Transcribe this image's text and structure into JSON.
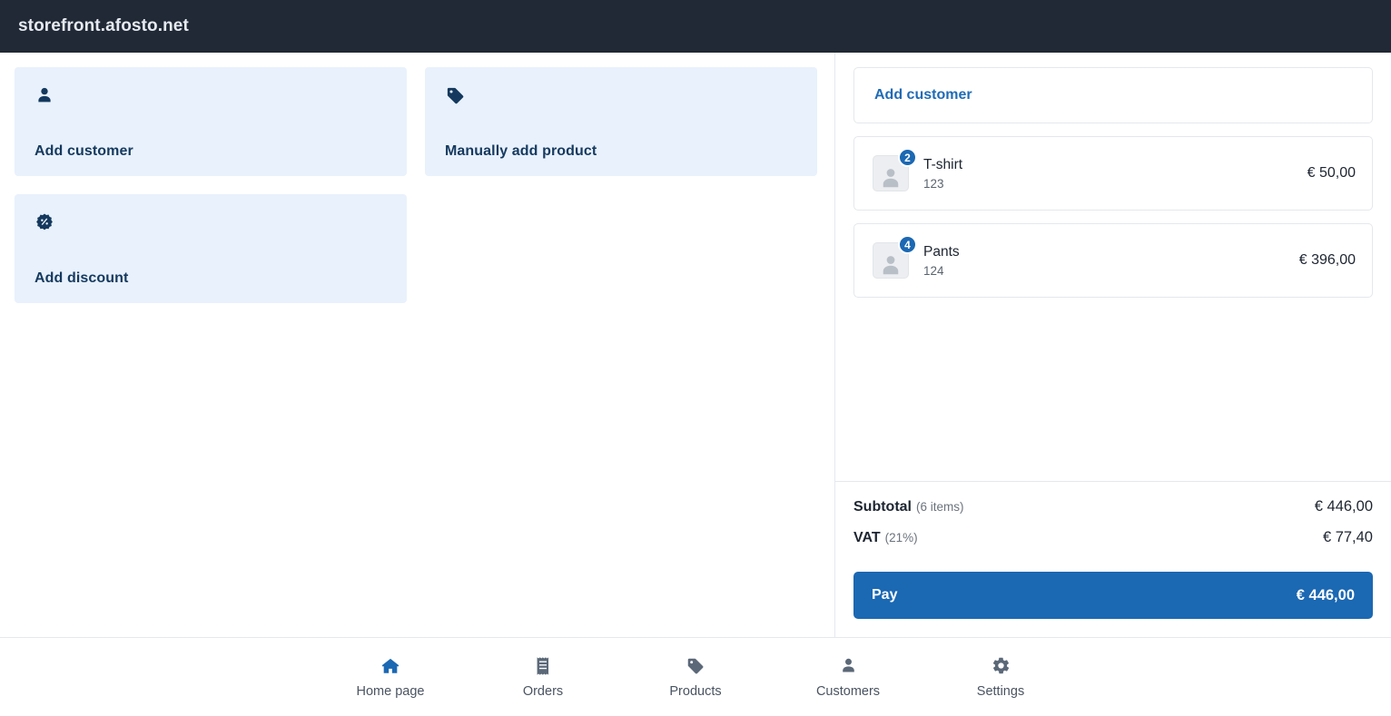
{
  "topbar": {
    "title": "storefront.afosto.net"
  },
  "actions": [
    {
      "label": "Add customer",
      "icon": "person-icon"
    },
    {
      "label": "Manually add product",
      "icon": "tag-icon"
    },
    {
      "label": "Add discount",
      "icon": "discount-badge-icon"
    }
  ],
  "cart": {
    "add_customer_label": "Add customer",
    "items": [
      {
        "qty": "2",
        "name": "T-shirt",
        "sku": "123",
        "price": "€ 50,00"
      },
      {
        "qty": "4",
        "name": "Pants",
        "sku": "124",
        "price": "€ 396,00"
      }
    ],
    "totals": [
      {
        "label": "Subtotal",
        "sub": "(6 items)",
        "value": "€ 446,00"
      },
      {
        "label": "VAT",
        "sub": "(21%)",
        "value": "€ 77,40"
      }
    ],
    "pay": {
      "label": "Pay",
      "amount": "€ 446,00"
    }
  },
  "bottom_nav": [
    {
      "label": "Home page",
      "icon": "home-icon",
      "active": true
    },
    {
      "label": "Orders",
      "icon": "receipt-icon",
      "active": false
    },
    {
      "label": "Products",
      "icon": "tag-icon",
      "active": false
    },
    {
      "label": "Customers",
      "icon": "person-icon",
      "active": false
    },
    {
      "label": "Settings",
      "icon": "gear-icon",
      "active": false
    }
  ],
  "colors": {
    "header_bg": "#212936",
    "card_bg": "#e8f1fc",
    "accent_blue": "#1b68b3",
    "link_blue": "#1f6bb5",
    "dark_navy": "#15395e"
  }
}
